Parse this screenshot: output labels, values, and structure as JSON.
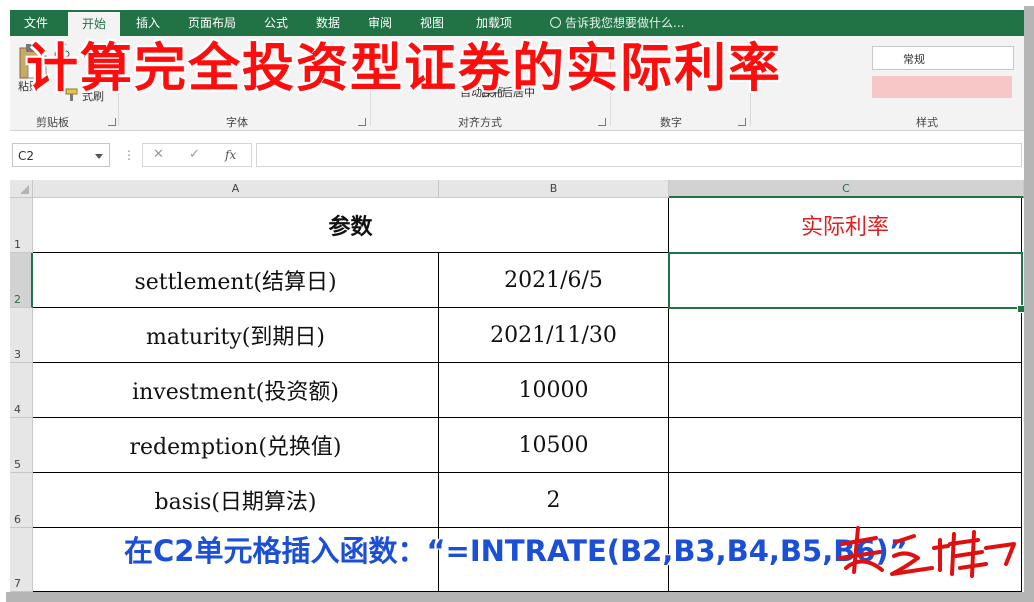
{
  "tabs": [
    "文件",
    "开始",
    "插入",
    "页面布局",
    "公式",
    "数据",
    "审阅",
    "视图",
    "加载项"
  ],
  "active_tab": "开始",
  "tell_me": "告诉我您想要做什么...",
  "ribbon": {
    "clipboard": {
      "cut": "切",
      "paste": "粘贴",
      "format_painter": "式刷"
    },
    "alignment": {
      "wrap": "自动换行",
      "merge": "合并后居中"
    },
    "styles": {
      "normal": "常规"
    },
    "groups": [
      "剪贴板",
      "字体",
      "对齐方式",
      "数字",
      "样式"
    ]
  },
  "overlay_title": "计算完全投资型证券的实际利率",
  "formula_bar": {
    "name_box": "C2",
    "cancel": "✕",
    "enter": "✓",
    "fx": "fx",
    "formula": ""
  },
  "columns": [
    "A",
    "B",
    "C"
  ],
  "rows": [
    "1",
    "2",
    "3",
    "4",
    "5",
    "6",
    "7"
  ],
  "sheet": {
    "header_param": "参数",
    "header_result": "实际利率",
    "params": [
      {
        "name": "settlement(结算日)",
        "value": "2021/6/5"
      },
      {
        "name": "maturity(到期日)",
        "value": "2021/11/30"
      },
      {
        "name": "investment(投资额)",
        "value": "10000"
      },
      {
        "name": "redemption(兑换值)",
        "value": "10500"
      },
      {
        "name": "basis(日期算法)",
        "value": "2"
      }
    ]
  },
  "caption": "在C2单元格插入函数：“=INTRATE(B2,B3,B4,B5,B6)”",
  "colors": {
    "excel_green": "#217346",
    "title_red": "#ff0d0d",
    "result_red": "#e02020",
    "caption_blue": "#1a4fd6"
  }
}
